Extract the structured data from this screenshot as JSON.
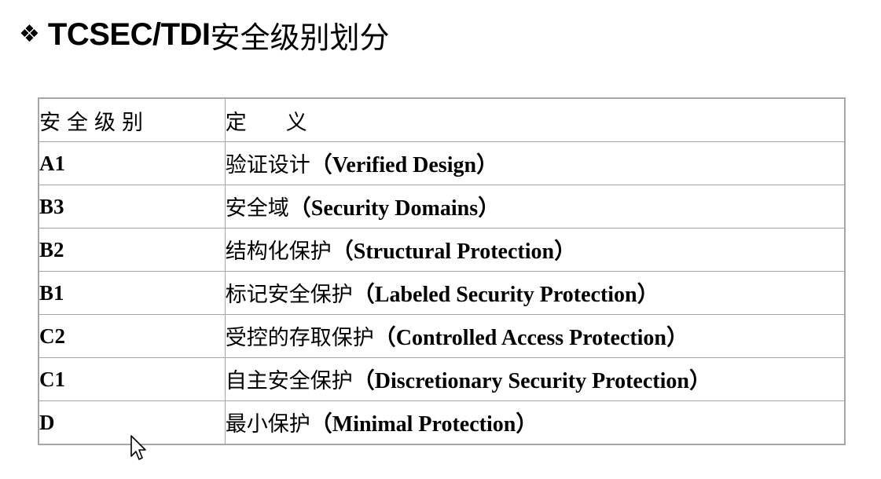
{
  "title": {
    "bullet": "❖",
    "latin": "TCSEC/TDI",
    "cjk": "安全级别划分"
  },
  "table": {
    "headers": {
      "level": "安全级别",
      "definition": "定义"
    },
    "rows": [
      {
        "level": "A1",
        "cn": "验证设计",
        "en": "（Verified Design）"
      },
      {
        "level": "B3",
        "cn": "安全域",
        "en": "（Security Domains）"
      },
      {
        "level": "B2",
        "cn": "结构化保护",
        "en": "（Structural Protection）"
      },
      {
        "level": "B1",
        "cn": "标记安全保护",
        "en": "（Labeled Security Protection）"
      },
      {
        "level": "C2",
        "cn": "受控的存取保护",
        "en": "（Controlled Access Protection）"
      },
      {
        "level": "C1",
        "cn": "自主安全保护",
        "en": "（Discretionary Security Protection）"
      },
      {
        "level": "D",
        "cn": "最小保护",
        "en": "（Minimal Protection）"
      }
    ]
  },
  "icons": {
    "bullet": "diamond-bullet-icon",
    "cursor": "mouse-pointer-icon"
  },
  "colors": {
    "border": "#a6a6a6",
    "text": "#000000",
    "background": "#ffffff"
  }
}
